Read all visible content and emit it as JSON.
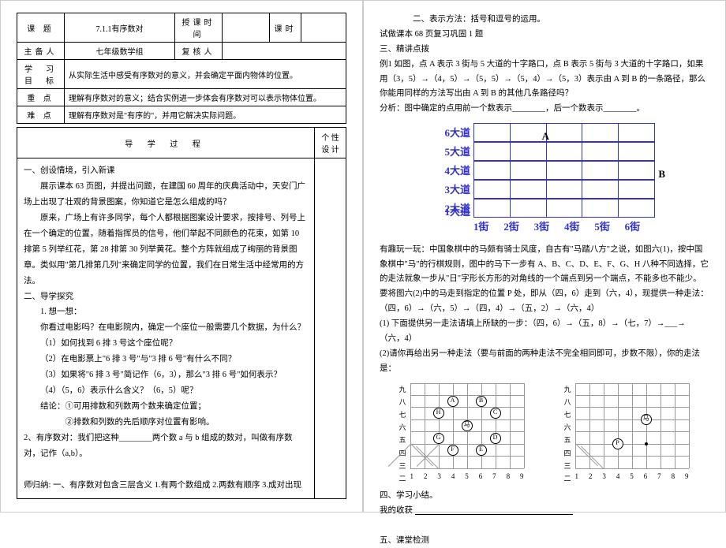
{
  "header": {
    "topic_lbl": "课  题",
    "topic": "7.1.1有序数对",
    "time_lbl": "授课时间",
    "period_lbl": "课时",
    "presenter_lbl": "主备人",
    "presenter": "七年级数学组",
    "reviewer_lbl": "复核人",
    "goal_lbl": "学  习\n目  标",
    "goal": "从实际生活中感受有序数对的意义，并会确定平面内物体的位置。",
    "key_lbl": "重    点",
    "key": "理解有序数对的意义；结合实例进一步体会有序数对可以表示物体位置。",
    "diff_lbl": "难    点",
    "diff": "理解有序数对是\"有序的\"，并用它解决实际问题。",
    "process_lbl": "导  学  过  程",
    "design_lbl": "个 性\n设 计"
  },
  "left": {
    "s1_title": "一、创设情境，引入新课",
    "s1_p1": "展示课本 63 页图，并提出问题，在建国 60 周年的庆典活动中，天安门广场上出现了壮观的背景图案，你知道它是怎么组成的吗？",
    "s1_p2": "原来，广场上有许多同学，每个人都根据图案设计要求，按排号、列号上在一个确定的位置，随着指挥员的信号，他们举起不同颜色的花束，如第 10 排第 5 列举红花，第 28 排第 30 列举黄花。整个方阵就组成了绚丽的背景图章。类似用\"第几排第几列\"来确定同学的位置，我们在日常生活中经常用的方法。",
    "s2_title": "二、导学探究",
    "s2_q1_title": "1. 想一想：",
    "s2_q1": "你看过电影吗？在电影院内，确定一个座位一般需要几个数据，为什么？",
    "s2_q2": "（1）如何找到 6 排 3 号这个座位呢？",
    "s2_q3": "（2）在电影票上\"6 排 3 号\"与\"3 排 6 号\"有什么不同？",
    "s2_q4": "（3）如果将\"6 排 3 号\"简记作（6，3），那么\"3 排 6 号\"如何表示？",
    "s2_q5": "（4）（5，6）表示什么含义？（6，5）呢？",
    "s2_conc1": "结论：①可用排数和列数两个数来确定位置；",
    "s2_conc2": "②排数和列数的先后顺序对位置有影响。",
    "s2_def": "2、有序数对：我们把这种________两个数 a 与 b 组成的数对，叫做有序数对，记作（a,b）。",
    "s2_summary": "师归纳:  一、有序数对包含三层含义 1.有两个数组成 2.两数有顺序 3.成对出现"
  },
  "right": {
    "r_p1": "二、表示方法：括号和逗号的运用。",
    "r_p2": "试做课本 68 页复习巩固 1 题",
    "r_s3": "三、精讲点拨",
    "r_ex1": "例1   如图，点 A 表示 3 街与 5 大道的十字路口，点 B 表示 5 街与 3 大道的十字路口，如果用（3，5）→（4，5）→（5，5）→（5，4）→（5，3）表示由 A 到 B 的一条路径，那么你能用同样的方法写出由 A 到 B 的其他几条路径吗？",
    "r_analysis": "分析：图中确定的点用前一个数表示________，后一个数表示________。",
    "grid": {
      "rows": [
        "6大道",
        "5大道",
        "4大道",
        "3大道",
        "2大道",
        "1大道"
      ],
      "cols": [
        "1街",
        "2街",
        "3街",
        "4街",
        "5街",
        "6街"
      ],
      "A": "A",
      "B": "B"
    },
    "r_fun": "有趣玩一玩：中国象棋中的马颇有骑士风度，自古有\"马踏八方\"之说，如图六(1)，按中国象棋中\"马\"的行棋规则，图中的马下一步有 A、B、C、D、E、F、G、H 八种不同选择，它的走法就象一步从\"日\"字形长方形的对角线的一个端点到另一个端点，不能多也不能少。要将图六(2)中的马走到指定的位置 P 处，即从（四，6）走到（六，4），现提供一种走法：（四，6）→（六，5）→（四，4）→（五，2）→（六，4）",
    "r_q1": "(1) 下面提供另一走法请填上所缺的一步：（四，6）→（五，8）→（七，7）→___→（六，4）",
    "r_q2": "(2)请你再给出另一种走法（要与前面的两种走法不完全相同即可，步数不限），你的走法是：",
    "chess": {
      "v_labels": [
        "九",
        "八",
        "七",
        "六",
        "五",
        "四",
        "三",
        "二"
      ],
      "h_labels": [
        "1",
        "2",
        "3",
        "4",
        "5",
        "6",
        "7",
        "8",
        "9"
      ],
      "pieces1": [
        "A",
        "B",
        "C",
        "D",
        "E",
        "F",
        "G",
        "H"
      ],
      "ma": "马",
      "p": "P"
    },
    "r_s4": "四、学习小结。",
    "r_s4_q": "我的收获 ",
    "r_s5": "五、课堂检测"
  }
}
